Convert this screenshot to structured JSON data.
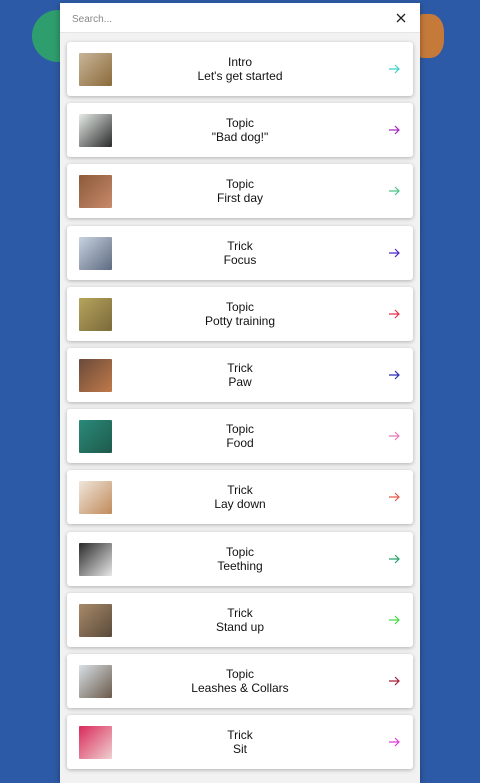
{
  "search": {
    "placeholder": "Search..."
  },
  "cards": [
    {
      "category": "Intro",
      "title": "Let's get started",
      "arrow_color": "#3fcfc9",
      "thumb_colors": [
        "#c9b59a",
        "#8a6a3a"
      ]
    },
    {
      "category": "Topic",
      "title": "\"Bad dog!\"",
      "arrow_color": "#a629c2",
      "thumb_colors": [
        "#e6ece8",
        "#2a2a2a"
      ]
    },
    {
      "category": "Topic",
      "title": "First day",
      "arrow_color": "#4cc48a",
      "thumb_colors": [
        "#8a5a3a",
        "#c98a6a"
      ]
    },
    {
      "category": "Trick",
      "title": "Focus",
      "arrow_color": "#4a28c8",
      "thumb_colors": [
        "#c8d3e0",
        "#5d6a80"
      ]
    },
    {
      "category": "Topic",
      "title": "Potty training",
      "arrow_color": "#e5334a",
      "thumb_colors": [
        "#b6a45c",
        "#7a6a3a"
      ]
    },
    {
      "category": "Trick",
      "title": "Paw",
      "arrow_color": "#2b2bb8",
      "thumb_colors": [
        "#6a4a3a",
        "#c07a4a"
      ]
    },
    {
      "category": "Topic",
      "title": "Food",
      "arrow_color": "#e879b8",
      "thumb_colors": [
        "#2a8a7a",
        "#1e5a4a"
      ]
    },
    {
      "category": "Trick",
      "title": "Lay down",
      "arrow_color": "#e85a4a",
      "thumb_colors": [
        "#f0e6dc",
        "#c08a5a"
      ]
    },
    {
      "category": "Topic",
      "title": "Teething",
      "arrow_color": "#28a26a",
      "thumb_colors": [
        "#2a2a2a",
        "#e8e8e8"
      ]
    },
    {
      "category": "Trick",
      "title": "Stand up",
      "arrow_color": "#4ad64a",
      "thumb_colors": [
        "#a88a6a",
        "#5a4a3a"
      ]
    },
    {
      "category": "Topic",
      "title": "Leashes & Collars",
      "arrow_color": "#a81e3a",
      "thumb_colors": [
        "#d8e0e6",
        "#6a5a4a"
      ]
    },
    {
      "category": "Trick",
      "title": "Sit",
      "arrow_color": "#e03ad6",
      "thumb_colors": [
        "#d82a5a",
        "#f0d0d0"
      ]
    }
  ]
}
